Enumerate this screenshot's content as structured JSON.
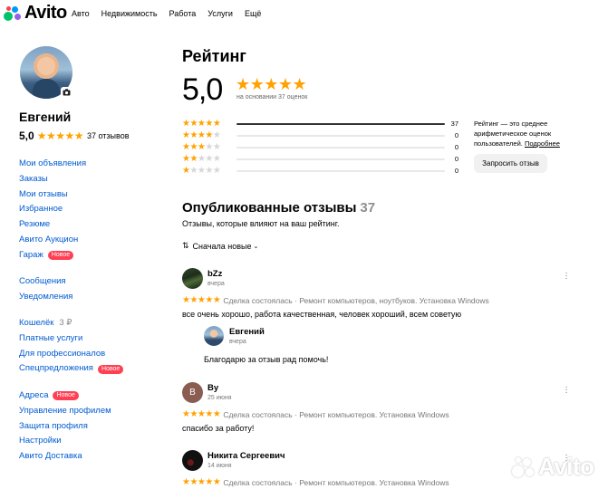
{
  "header": {
    "logo_text": "Avito",
    "nav": [
      "Авто",
      "Недвижимость",
      "Работа",
      "Услуги",
      "Ещё"
    ]
  },
  "colors": {
    "link": "#005bd1",
    "star": "#ffa200",
    "badge": "#ff4053",
    "logo_green": "#00c26a",
    "logo_blue": "#0099f7",
    "logo_red": "#ff4053",
    "logo_purple": "#965eeb"
  },
  "profile": {
    "name": "Евгений",
    "rating": "5,0",
    "stars": 5,
    "reviews_count": "37 отзывов"
  },
  "sidebar": {
    "group1": [
      {
        "label": "Мои объявления"
      },
      {
        "label": "Заказы"
      },
      {
        "label": "Мои отзывы"
      },
      {
        "label": "Избранное"
      },
      {
        "label": "Резюме"
      },
      {
        "label": "Авито Аукцион"
      },
      {
        "label": "Гараж",
        "badge": "Новое"
      }
    ],
    "group2": [
      {
        "label": "Сообщения"
      },
      {
        "label": "Уведомления"
      }
    ],
    "group3": [
      {
        "label": "Кошелёк",
        "extra": "3 ₽"
      },
      {
        "label": "Платные услуги"
      },
      {
        "label": "Для профессионалов"
      },
      {
        "label": "Спецпредложения",
        "badge": "Новое"
      }
    ],
    "group4": [
      {
        "label": "Адреса",
        "badge": "Новое"
      },
      {
        "label": "Управление профилем"
      },
      {
        "label": "Защита профиля"
      },
      {
        "label": "Настройки"
      },
      {
        "label": "Авито Доставка"
      }
    ]
  },
  "rating": {
    "title": "Рейтинг",
    "score": "5,0",
    "based_on": "на основании 37 оценок",
    "distribution": [
      {
        "stars": 5,
        "count": "37",
        "fraction": 1.0
      },
      {
        "stars": 4,
        "count": "0",
        "fraction": 0
      },
      {
        "stars": 3,
        "count": "0",
        "fraction": 0
      },
      {
        "stars": 2,
        "count": "0",
        "fraction": 0
      },
      {
        "stars": 1,
        "count": "0",
        "fraction": 0
      }
    ],
    "note": "Рейтинг — это среднее арифметическое оценок пользователей.",
    "note_link": "Подробнее",
    "ask_button": "Запросить отзыв"
  },
  "reviews_section": {
    "title": "Опубликованные отзывы",
    "count": "37",
    "subtitle": "Отзывы, которые влияют на ваш рейтинг.",
    "sort_label": "Сначала новые"
  },
  "reviews": [
    {
      "author": "bZz",
      "date": "вчера",
      "meta": "Сделка состоялась · Ремонт компьютеров, ноутбуков. Установка Windows",
      "text": "все очень хорошо, работа качественная, человек хороший, всем советую",
      "reply": {
        "author": "Евгений",
        "date": "вчера",
        "text": "Благодарю за отзыв рад помочь!"
      }
    },
    {
      "author": "By",
      "avatar_letter": "B",
      "date": "25 июня",
      "meta": "Сделка состоялась · Ремонт компьютеров. Установка Windows",
      "text": "спасибо за работу!"
    },
    {
      "author": "Никита Сергеевич",
      "date": "14 июня",
      "meta": "Сделка состоялась · Ремонт компьютеров. Установка Windows"
    }
  ],
  "watermark": "Avito"
}
